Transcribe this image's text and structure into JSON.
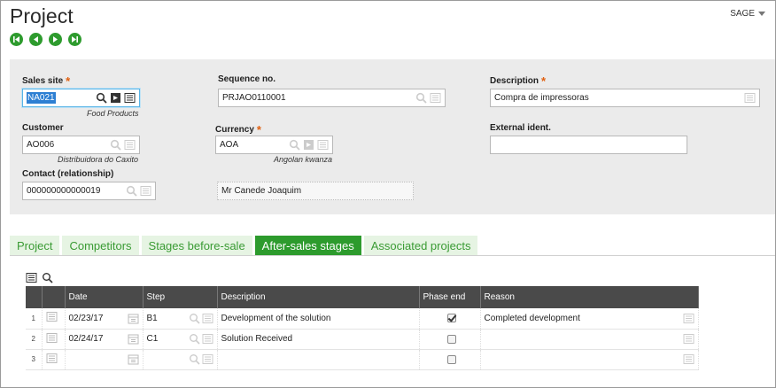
{
  "header": {
    "title": "Project",
    "user_menu": "SAGE",
    "nav": [
      "first-record-icon",
      "previous-record-icon",
      "next-record-icon",
      "last-record-icon"
    ]
  },
  "form": {
    "sales_site": {
      "label": "Sales site",
      "value": "NA021",
      "sub": "Food Products"
    },
    "sequence_no": {
      "label": "Sequence no.",
      "value": "PRJAO0110001"
    },
    "description": {
      "label": "Description",
      "value": "Compra de impressoras"
    },
    "customer": {
      "label": "Customer",
      "value": "AO006",
      "sub": "Distribuidora do Caxito"
    },
    "currency": {
      "label": "Currency",
      "value": "AOA",
      "sub": "Angolan kwanza"
    },
    "external_ident": {
      "label": "External ident.",
      "value": ""
    },
    "contact": {
      "label": "Contact (relationship)",
      "value": "000000000000019",
      "name": "Mr Canede Joaquim"
    }
  },
  "tabs": [
    {
      "label": "Project",
      "active": false
    },
    {
      "label": "Competitors",
      "active": false
    },
    {
      "label": "Stages before-sale",
      "active": false
    },
    {
      "label": "After-sales stages",
      "active": true
    },
    {
      "label": "Associated projects",
      "active": false
    }
  ],
  "grid": {
    "columns": [
      "Date",
      "Step",
      "Description",
      "Phase end",
      "Reason"
    ],
    "rows": [
      {
        "num": "1",
        "date": "02/23/17",
        "step": "B1",
        "description": "Development of the solution",
        "phase_end": true,
        "reason": "Completed development"
      },
      {
        "num": "2",
        "date": "02/24/17",
        "step": "C1",
        "description": "Solution Received",
        "phase_end": false,
        "reason": ""
      },
      {
        "num": "3",
        "date": "",
        "step": "",
        "description": "",
        "phase_end": false,
        "reason": ""
      }
    ]
  },
  "colors": {
    "accent": "#2d9b2d",
    "required": "#e06010",
    "grid_header": "#4a4a4a",
    "focus": "#58b4e6"
  }
}
